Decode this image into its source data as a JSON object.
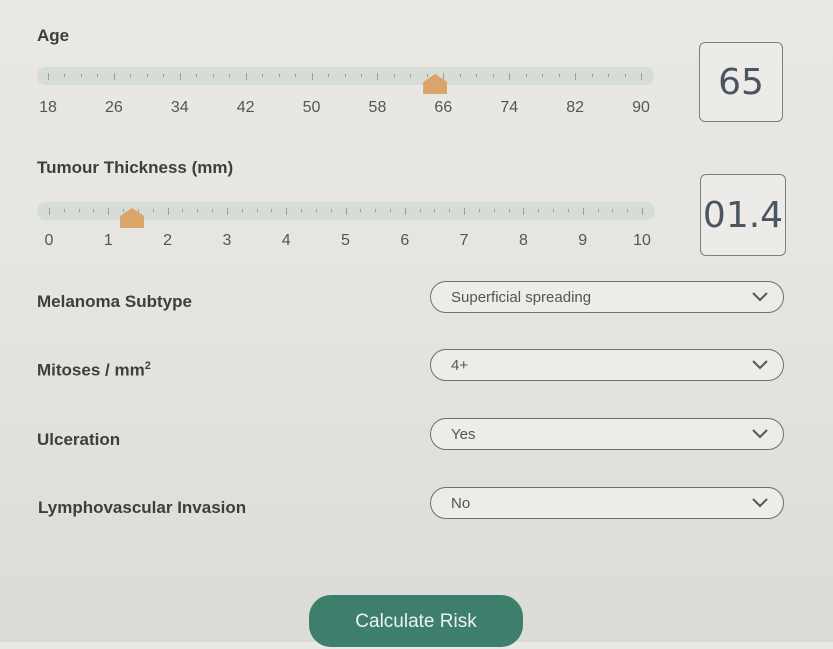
{
  "age": {
    "label": "Age",
    "value": "65",
    "slider_value": 65,
    "min": 18,
    "max": 90,
    "tick_labels": [
      "18",
      "26",
      "34",
      "42",
      "50",
      "58",
      "66",
      "74",
      "82",
      "90"
    ]
  },
  "thickness": {
    "label": "Tumour Thickness (mm)",
    "value": "01.4",
    "slider_value": 1.4,
    "min": 0,
    "max": 10,
    "tick_labels": [
      "0",
      "1",
      "2",
      "3",
      "4",
      "5",
      "6",
      "7",
      "8",
      "9",
      "10"
    ]
  },
  "subtype": {
    "label": "Melanoma Subtype",
    "selected": "Superficial spreading"
  },
  "mitoses": {
    "label": "Mitoses / mm",
    "label_sup": "2",
    "selected": "4+"
  },
  "ulceration": {
    "label": "Ulceration",
    "selected": "Yes"
  },
  "lvi": {
    "label": "Lymphovascular Invasion",
    "selected": "No"
  },
  "calculate": {
    "label": "Calculate Risk"
  },
  "colors": {
    "accent": "#3e7e6d",
    "thumb": "#d9a56a"
  },
  "icons": {
    "dropdown": "chevron-down-icon"
  }
}
